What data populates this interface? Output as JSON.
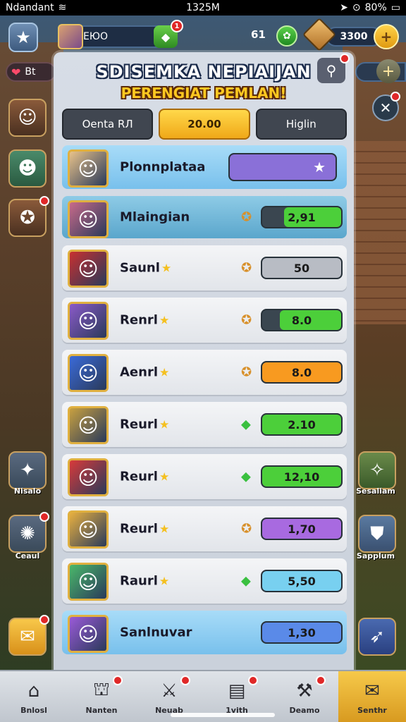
{
  "status_bar": {
    "carrier": "Ndandant",
    "time": "1325M",
    "battery": "80%"
  },
  "hud": {
    "profile_name": "ЕЮО",
    "resource_a_value": "61",
    "resource_b_value": "3300",
    "badge_count": "1"
  },
  "left_panel": {
    "heart_label": "Bt"
  },
  "panel": {
    "title": "SDISEMKA NEPIAIJAN",
    "subtitle": "PERENGIAT PEMLAN!",
    "tabs": [
      {
        "label": "Oenta RЛ"
      },
      {
        "label": "20.00"
      },
      {
        "label": "Higlin"
      }
    ],
    "rows": [
      {
        "name": "Plonnplataa",
        "value": "",
        "fill_pct": 100,
        "fill_color": "#8a70d8",
        "style": "highlight-a",
        "portrait_color": "#e8c28a",
        "medal": ""
      },
      {
        "name": "Mlaingian",
        "value": "2,91",
        "fill_pct": 72,
        "fill_color": "#4ccf3a",
        "style": "highlight-b",
        "portrait_color": "#c86a8a",
        "medal": "medal-icon"
      },
      {
        "name": "Saunl",
        "value": "50",
        "fill_pct": 100,
        "fill_color": "#b8bcc4",
        "style": "normal",
        "portrait_color": "#c83030",
        "medal": "medal-icon"
      },
      {
        "name": "Renrl",
        "value": "8.0",
        "fill_pct": 78,
        "fill_color": "#4ccf3a",
        "style": "normal",
        "portrait_color": "#8a5ac8",
        "medal": "medal-icon"
      },
      {
        "name": "Aenrl",
        "value": "8.0",
        "fill_pct": 100,
        "fill_color": "#f89a20",
        "style": "normal",
        "portrait_color": "#3a6ad8",
        "medal": "medal-icon"
      },
      {
        "name": "Reurl",
        "value": "2.10",
        "fill_pct": 100,
        "fill_color": "#4ccf3a",
        "style": "normal",
        "portrait_color": "#c8a040",
        "medal": "gem-icon"
      },
      {
        "name": "Reurl",
        "value": "12,10",
        "fill_pct": 100,
        "fill_color": "#4ccf3a",
        "style": "normal",
        "portrait_color": "#d83a3a",
        "medal": "gem-icon"
      },
      {
        "name": "Reurl",
        "value": "1,70",
        "fill_pct": 100,
        "fill_color": "#a86ae0",
        "style": "normal",
        "portrait_color": "#e8b040",
        "medal": "medal-icon"
      },
      {
        "name": "Raurl",
        "value": "5,50",
        "fill_pct": 100,
        "fill_color": "#78d0f0",
        "style": "normal",
        "portrait_color": "#4ab86a",
        "medal": "gem-icon"
      },
      {
        "name": "Sanlnuvar",
        "value": "1,30",
        "fill_pct": 100,
        "fill_color": "#5a8ae8",
        "style": "bottom",
        "portrait_color": "#9a5ad8",
        "medal": ""
      }
    ]
  },
  "side_left": [
    {
      "label": "Nisalo"
    },
    {
      "label": "Ceaul"
    }
  ],
  "side_right": [
    {
      "label": "Sesaliam"
    },
    {
      "label": "Sapplum"
    }
  ],
  "nav": [
    {
      "label": "Bnlosl",
      "icon": "home-icon"
    },
    {
      "label": "Nanten",
      "icon": "shop-icon"
    },
    {
      "label": "Neuab",
      "icon": "battle-icon"
    },
    {
      "label": "1vith",
      "icon": "cards-icon"
    },
    {
      "label": "Deamo",
      "icon": "sword-icon"
    },
    {
      "label": "Senthr",
      "icon": "mail-icon"
    }
  ],
  "colors": {
    "accent": "#f0a818",
    "panel": "#d7dde6",
    "badge": "#e02828"
  }
}
